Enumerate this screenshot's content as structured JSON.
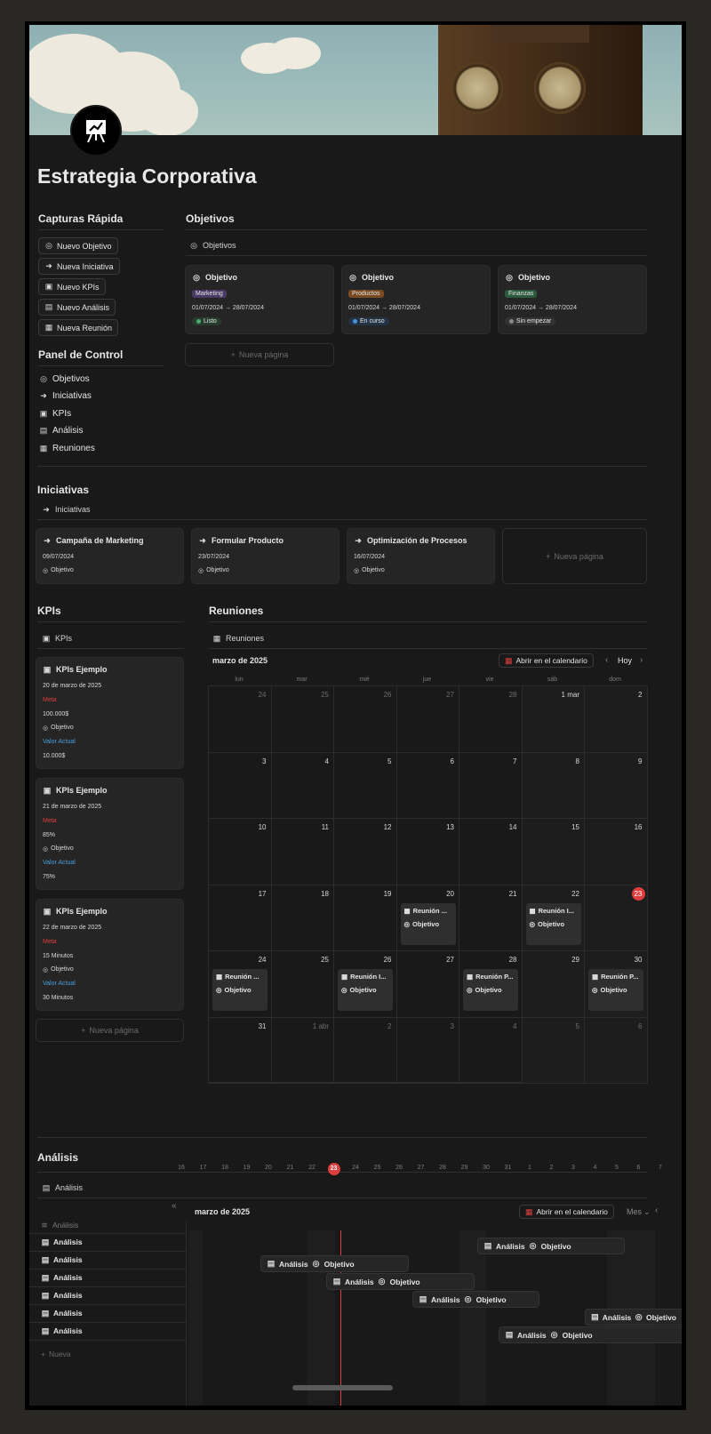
{
  "page": {
    "title": "Estrategia Corporativa"
  },
  "quick_capture": {
    "heading": "Capturas Rápida",
    "buttons": [
      {
        "label": "Nuevo Objetivo",
        "icon": "target-icon"
      },
      {
        "label": "Nueva Iniciativa",
        "icon": "signpost-icon"
      },
      {
        "label": "Nuevo KPIs",
        "icon": "clipboard-icon"
      },
      {
        "label": "Nuevo Análisis",
        "icon": "chart-icon"
      },
      {
        "label": "Nueva Reunión",
        "icon": "calendar-icon"
      }
    ]
  },
  "control_panel": {
    "heading": "Panel de Control",
    "items": [
      {
        "label": "Objetivos",
        "icon": "target-icon"
      },
      {
        "label": "Iniciativas",
        "icon": "signpost-icon"
      },
      {
        "label": "KPIs",
        "icon": "clipboard-icon"
      },
      {
        "label": "Análisis",
        "icon": "chart-icon"
      },
      {
        "label": "Reuniones",
        "icon": "calendar-icon"
      }
    ]
  },
  "objetivos": {
    "heading": "Objetivos",
    "view": "Objetivos",
    "cards": [
      {
        "title": "Objetivo",
        "tag": "Marketing",
        "tag_color": "#4b3a66",
        "dates": "01/07/2024 → 28/07/2024",
        "status": "Listo",
        "status_bg": "#263d2e",
        "dot": "#4dab6f"
      },
      {
        "title": "Objetivo",
        "tag": "Productos",
        "tag_color": "#7a4a22",
        "dates": "01/07/2024 → 28/07/2024",
        "status": "En curso",
        "status_bg": "#233447",
        "dot": "#4a90d9"
      },
      {
        "title": "Objetivo",
        "tag": "Finanzas",
        "tag_color": "#2b5a3d",
        "dates": "01/07/2024 → 28/07/2024",
        "status": "Sin empezar",
        "status_bg": "#333333",
        "dot": "#8a8a8a"
      }
    ],
    "new_page": "Nueva página"
  },
  "iniciativas": {
    "heading": "Iniciativas",
    "view": "Iniciativas",
    "cards": [
      {
        "title": "Campaña de Marketing",
        "date": "09/07/2024",
        "rel": "Objetivo"
      },
      {
        "title": "Formular Producto",
        "date": "23/07/2024",
        "rel": "Objetivo"
      },
      {
        "title": "Optimización de Procesos",
        "date": "16/07/2024",
        "rel": "Objetivo"
      }
    ],
    "new_page": "Nueva página"
  },
  "kpis": {
    "heading": "KPIs",
    "view": "KPIs",
    "cards": [
      {
        "title": "KPIs Ejemplo",
        "date": "20 de marzo de 2025",
        "meta_label": "Meta",
        "meta": "100.000$",
        "rel": "Objetivo",
        "actual_label": "Valor Actual",
        "actual": "10.000$"
      },
      {
        "title": "KPIs Ejemplo",
        "date": "21 de marzo de 2025",
        "meta_label": "Meta",
        "meta": "85%",
        "rel": "Objetivo",
        "actual_label": "Valor Actual",
        "actual": "75%"
      },
      {
        "title": "KPIs Ejemplo",
        "date": "22 de marzo de 2025",
        "meta_label": "Meta",
        "meta": "15 Minutos",
        "rel": "Objetivo",
        "actual_label": "Valor Actual",
        "actual": "30 Minutos"
      }
    ],
    "new_page": "Nueva página"
  },
  "reuniones": {
    "heading": "Reuniones",
    "view": "Reuniones",
    "month": "marzo de 2025",
    "open_calendar": "Abrir en el calendario",
    "today": "Hoy",
    "days": [
      "lun",
      "mar",
      "mié",
      "jue",
      "vie",
      "sáb",
      "dom"
    ],
    "weeks": [
      [
        "24",
        "25",
        "26",
        "27",
        "28",
        "1 mar",
        "2"
      ],
      [
        "3",
        "4",
        "5",
        "6",
        "7",
        "8",
        "9"
      ],
      [
        "10",
        "11",
        "12",
        "13",
        "14",
        "15",
        "16"
      ],
      [
        "17",
        "18",
        "19",
        "20",
        "21",
        "22",
        "23"
      ],
      [
        "24",
        "25",
        "26",
        "27",
        "28",
        "29",
        "30"
      ],
      [
        "31",
        "1 abr",
        "2",
        "3",
        "4",
        "5",
        "6"
      ]
    ],
    "events": [
      {
        "title": "Reunión ...",
        "rel": "Objetivo"
      },
      {
        "title": "Reunión I...",
        "rel": "Objetivo"
      },
      {
        "title": "Reunión ...",
        "rel": "Objetivo"
      },
      {
        "title": "Reunión I...",
        "rel": "Objetivo"
      },
      {
        "title": "Reunión P...",
        "rel": "Objetivo"
      },
      {
        "title": "Reunión P...",
        "rel": "Objetivo"
      }
    ],
    "today_color": "#e03e3e"
  },
  "analisis": {
    "heading": "Análisis",
    "view": "Análisis",
    "month": "marzo de 2025",
    "open_calendar": "Abrir en el calendario",
    "mode": "Mes",
    "timeline_days": [
      "16",
      "17",
      "18",
      "19",
      "20",
      "21",
      "22",
      "23",
      "24",
      "25",
      "26",
      "27",
      "28",
      "29",
      "30",
      "31",
      "1",
      "2",
      "3",
      "4",
      "5",
      "6",
      "7"
    ],
    "column_header": "Análisis",
    "rows": [
      "Análisis",
      "Análisis",
      "Análisis",
      "Análisis",
      "Análisis",
      "Análisis"
    ],
    "new_row": "Nueva",
    "bars": [
      {
        "label": "Análisis",
        "rel": "Objetivo"
      },
      {
        "label": "Análisis",
        "rel": "Objetivo"
      },
      {
        "label": "Análisis",
        "rel": "Objetivo"
      },
      {
        "label": "Análisis",
        "rel": "Objetivo"
      },
      {
        "label": "Análisis",
        "rel": "Objetivo"
      },
      {
        "label": "Análisis",
        "rel": "Objetivo"
      }
    ]
  },
  "colors": {
    "red": "#e03e3e",
    "blue": "#4a9fe0",
    "background": "#191919"
  }
}
